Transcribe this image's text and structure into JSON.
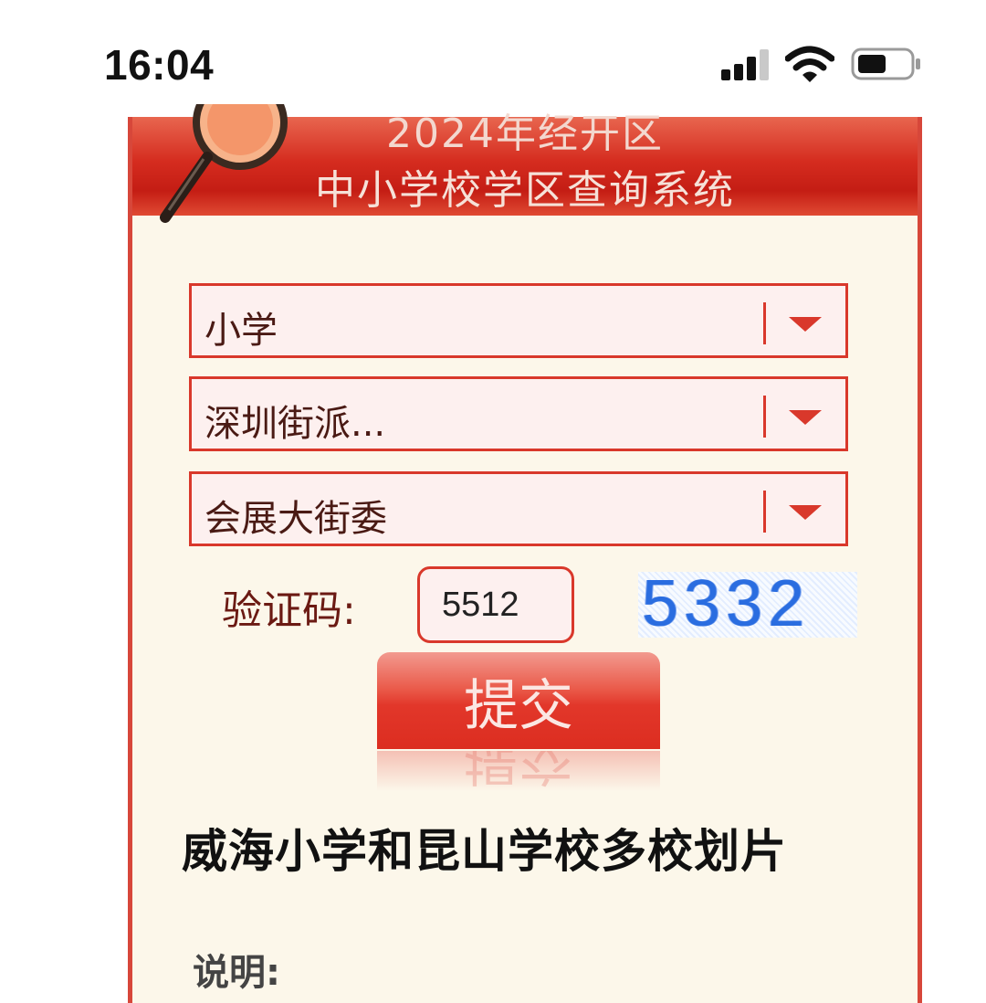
{
  "status_bar": {
    "time": "16:04"
  },
  "banner": {
    "line1": "2024年经开区",
    "line2": "中小学校学区查询系统"
  },
  "form": {
    "school_type": "小学",
    "street": "深圳街派...",
    "community": "会展大街委",
    "captcha_label": "验证码:",
    "captcha_value": "5512",
    "captcha_image_text": "5332",
    "submit_label": "提交"
  },
  "result": {
    "text": "威海小学和昆山学校多校划片"
  },
  "note": {
    "label": "说明:"
  },
  "colors": {
    "accent": "#d9382b",
    "card_bg": "#fcf7ea",
    "captcha_blue": "#2a6de0"
  }
}
